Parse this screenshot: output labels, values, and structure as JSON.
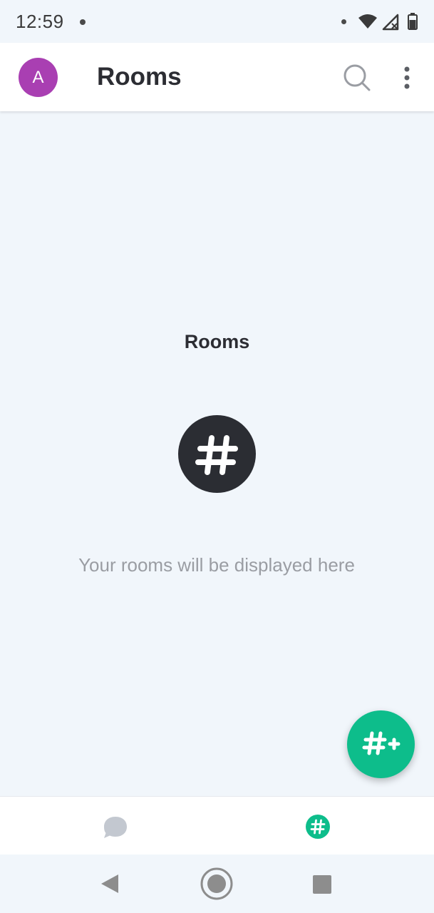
{
  "status_bar": {
    "time": "12:59"
  },
  "app_bar": {
    "avatar_letter": "A",
    "title": "Rooms",
    "colors": {
      "avatar": "#a93fb2"
    }
  },
  "empty_state": {
    "title": "Rooms",
    "message": "Your rooms will be displayed here"
  },
  "fab": {
    "icon": "create-room-icon",
    "color": "#0dbd8b"
  },
  "bottom_nav": {
    "items": [
      {
        "icon": "people-chat-icon",
        "selected": false
      },
      {
        "icon": "rooms-hash-icon",
        "selected": true,
        "color": "#0dbd8b"
      }
    ]
  },
  "system_nav": {
    "items": [
      "back-icon",
      "home-icon",
      "recents-icon"
    ]
  }
}
